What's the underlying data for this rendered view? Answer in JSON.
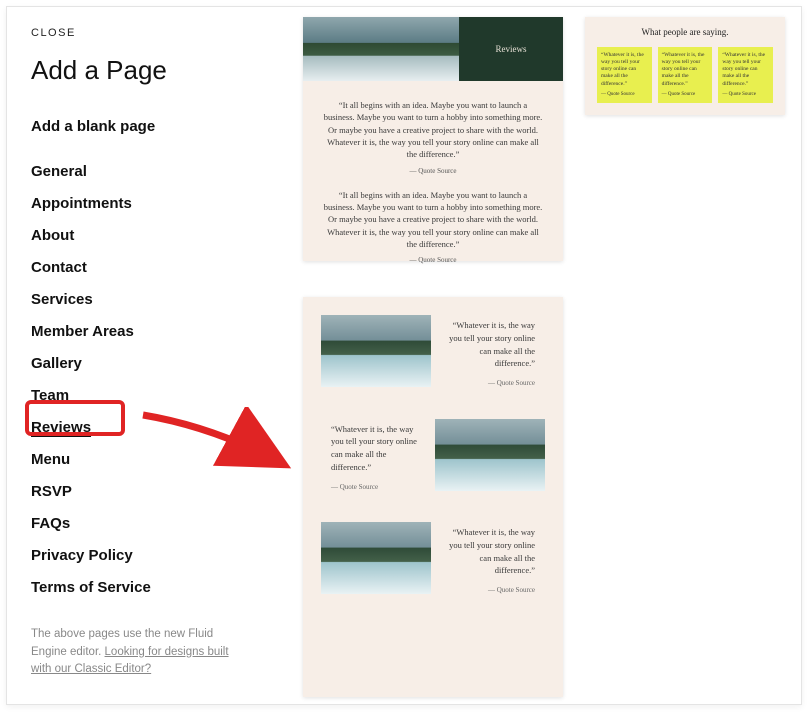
{
  "close_label": "CLOSE",
  "title": "Add a Page",
  "blank_label": "Add a blank page",
  "categories": [
    "General",
    "Appointments",
    "About",
    "Contact",
    "Services",
    "Member Areas",
    "Gallery",
    "Team",
    "Reviews",
    "Menu",
    "RSVP",
    "FAQs",
    "Privacy Policy",
    "Terms of Service"
  ],
  "active_category_index": 8,
  "footnote_prefix": "The above pages use the new Fluid Engine editor. ",
  "footnote_link": "Looking for designs built with our Classic Editor?",
  "template1": {
    "hero_label": "Reviews",
    "quote1": "“It all begins with an idea. Maybe you want to launch a business. Maybe you want to turn a hobby into something more. Or maybe you have a creative project to share with the world. Whatever it is, the way you tell your story online can make all the difference.”",
    "attr1": "— Quote Source",
    "quote2": "“It all begins with an idea. Maybe you want to launch a business. Maybe you want to turn a hobby into something more. Or maybe you have a creative project to share with the world. Whatever it is, the way you tell your story online can make all the difference.”",
    "attr2": "— Quote Source"
  },
  "template2": {
    "heading": "What people are saying.",
    "col_quote": "“Whatever it is, the way you tell your story online can make all the difference.”",
    "col_attr": "— Quote Source"
  },
  "template3": {
    "row_quote": "“Whatever it is, the way you tell your story online can make all the difference.”",
    "row_attr": "— Quote Source"
  }
}
